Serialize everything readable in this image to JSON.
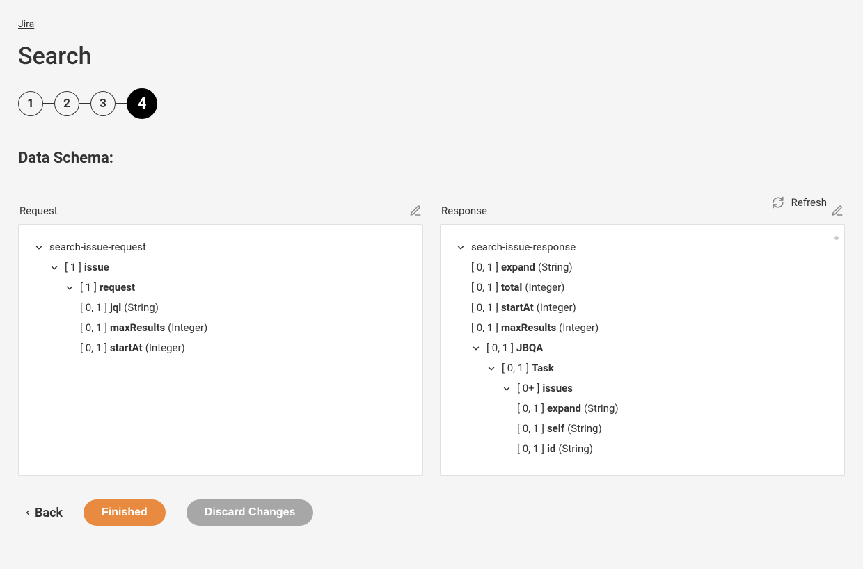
{
  "breadcrumb": "Jira",
  "page_title": "Search",
  "steps": {
    "s1": "1",
    "s2": "2",
    "s3": "3",
    "s4": "4"
  },
  "section_title": "Data Schema:",
  "refresh_label": "Refresh",
  "request": {
    "label": "Request",
    "root": "search-issue-request",
    "issue": {
      "card": "[ 1 ]",
      "name": "issue"
    },
    "request_node": {
      "card": "[ 1 ]",
      "name": "request"
    },
    "fields": {
      "jql": {
        "card": "[ 0, 1 ]",
        "name": "jql",
        "type": "(String)"
      },
      "maxResults": {
        "card": "[ 0, 1 ]",
        "name": "maxResults",
        "type": "(Integer)"
      },
      "startAt": {
        "card": "[ 0, 1 ]",
        "name": "startAt",
        "type": "(Integer)"
      }
    }
  },
  "response": {
    "label": "Response",
    "root": "search-issue-response",
    "fields": {
      "expand": {
        "card": "[ 0, 1 ]",
        "name": "expand",
        "type": "(String)"
      },
      "total": {
        "card": "[ 0, 1 ]",
        "name": "total",
        "type": "(Integer)"
      },
      "startAt": {
        "card": "[ 0, 1 ]",
        "name": "startAt",
        "type": "(Integer)"
      },
      "maxResults": {
        "card": "[ 0, 1 ]",
        "name": "maxResults",
        "type": "(Integer)"
      }
    },
    "jbqa": {
      "card": "[ 0, 1 ]",
      "name": "JBQA"
    },
    "task": {
      "card": "[ 0, 1 ]",
      "name": "Task"
    },
    "issues": {
      "card": "[ 0+ ]",
      "name": "issues"
    },
    "issue_fields": {
      "expand": {
        "card": "[ 0, 1 ]",
        "name": "expand",
        "type": "(String)"
      },
      "self": {
        "card": "[ 0, 1 ]",
        "name": "self",
        "type": "(String)"
      },
      "id": {
        "card": "[ 0, 1 ]",
        "name": "id",
        "type": "(String)"
      }
    }
  },
  "footer": {
    "back": "Back",
    "finished": "Finished",
    "discard": "Discard Changes"
  }
}
